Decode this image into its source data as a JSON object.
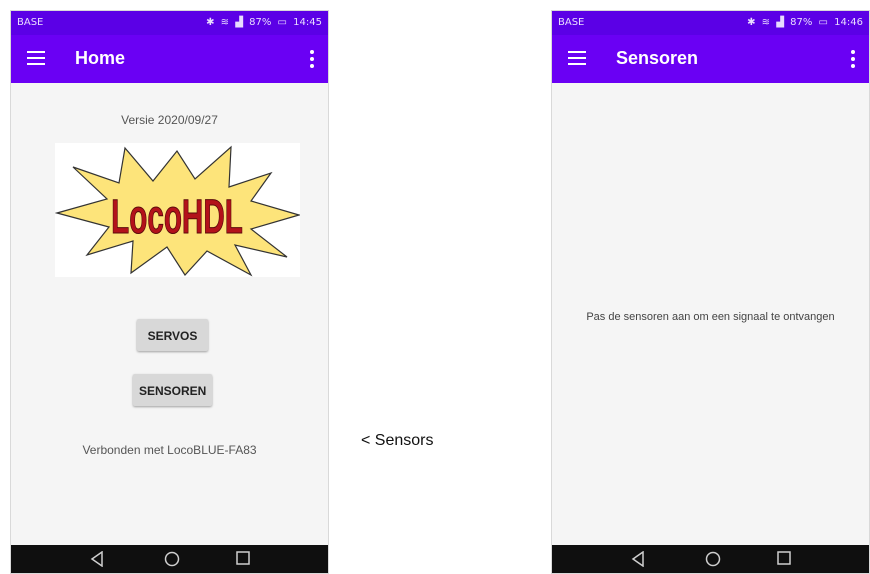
{
  "caption": "< Sensors",
  "colors": {
    "appbar": "#6a00f4",
    "statusbar": "#5b00e6",
    "screen_bg": "#f5f5f5",
    "button_bg": "#d8d8d8",
    "navbar": "#0f0f0f",
    "logo_star_fill": "#fde47a",
    "logo_text": "#b3121a"
  },
  "left_screen": {
    "statusbar": {
      "carrier": "BASE",
      "battery": "87%",
      "time": "14:45",
      "icons": [
        "bluetooth-icon",
        "wifi-icon",
        "signal-icon",
        "battery-icon"
      ]
    },
    "appbar": {
      "title": "Home",
      "menu_icon": "hamburger-icon",
      "overflow_icon": "more-vert-icon"
    },
    "version": "Versie 2020/09/27",
    "logo_text": "LocoHDL",
    "buttons": {
      "servos": "SERVOS",
      "sensoren": "SENSOREN"
    },
    "connection_status": "Verbonden met LocoBLUE-FA83",
    "navbar": [
      "back-icon",
      "home-icon",
      "recent-apps-icon"
    ]
  },
  "right_screen": {
    "statusbar": {
      "carrier": "BASE",
      "battery": "87%",
      "time": "14:46",
      "icons": [
        "bluetooth-icon",
        "wifi-icon",
        "signal-icon",
        "battery-icon"
      ]
    },
    "appbar": {
      "title": "Sensoren",
      "menu_icon": "hamburger-icon",
      "overflow_icon": "more-vert-icon"
    },
    "message": "Pas de sensoren aan om een signaal te ontvangen",
    "navbar": [
      "back-icon",
      "home-icon",
      "recent-apps-icon"
    ]
  }
}
